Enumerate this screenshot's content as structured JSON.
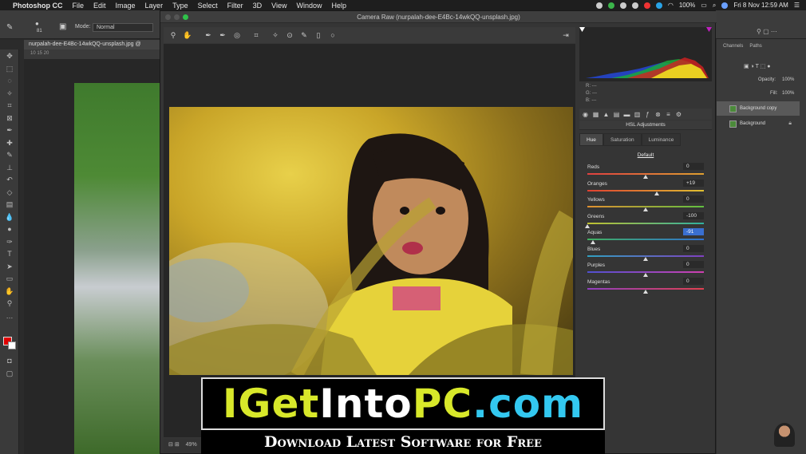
{
  "menubar": {
    "app": "Photoshop CC",
    "items": [
      "File",
      "Edit",
      "Image",
      "Layer",
      "Type",
      "Select",
      "Filter",
      "3D",
      "View",
      "Window",
      "Help"
    ],
    "battery": "100%",
    "datetime": "Fri 8 Nov  12:59 AM"
  },
  "options": {
    "mode_label": "Mode:",
    "mode_value": "Normal",
    "brush_size": "81"
  },
  "document": {
    "tab": "nurpalah-dee-E4Bc-14wkQQ-unsplash.jpg @",
    "ruler": "10      15      20"
  },
  "camera_raw": {
    "title": "Camera Raw (nurpalah-dee-E4Bc-14wkQQ-unsplash.jpg)",
    "zoom": "49%",
    "rgb": {
      "r": "R:  ---",
      "g": "G:  ---",
      "b": "B:  ---"
    },
    "panel_title": "HSL Adjustments",
    "tabs": [
      "Hue",
      "Saturation",
      "Luminance"
    ],
    "active_tab": "Hue",
    "default_label": "Default",
    "sliders": [
      {
        "label": "Reds",
        "value": "0",
        "level": 0,
        "colors": [
          "#e04040",
          "#e0a030"
        ]
      },
      {
        "label": "Oranges",
        "value": "+19",
        "level": 19,
        "colors": [
          "#e04030",
          "#e0c030"
        ]
      },
      {
        "label": "Yellows",
        "value": "0",
        "level": 0,
        "colors": [
          "#e09030",
          "#60c040"
        ]
      },
      {
        "label": "Greens",
        "value": "-100",
        "level": -100,
        "colors": [
          "#c0c030",
          "#30b0a0"
        ]
      },
      {
        "label": "Aquas",
        "value": "-91",
        "level": -91,
        "colors": [
          "#40b060",
          "#3070d0"
        ],
        "highlight": true
      },
      {
        "label": "Blues",
        "value": "0",
        "level": 0,
        "colors": [
          "#30a0c0",
          "#8040c0"
        ]
      },
      {
        "label": "Purples",
        "value": "0",
        "level": 0,
        "colors": [
          "#5050d0",
          "#d040b0"
        ]
      },
      {
        "label": "Magentas",
        "value": "0",
        "level": 0,
        "colors": [
          "#9040c0",
          "#e04050"
        ]
      }
    ]
  },
  "right_panel": {
    "tabs": [
      "Channels",
      "Paths"
    ],
    "opacity_label": "Opacity:",
    "opacity_value": "100%",
    "fill_label": "Fill:",
    "fill_value": "100%",
    "layers": [
      "Background copy",
      "Background"
    ]
  },
  "watermark": {
    "title_parts": [
      {
        "text": "IGet",
        "color": "#d8e82a"
      },
      {
        "text": "Into",
        "color": "#ffffff"
      },
      {
        "text": "PC",
        "color": "#d8e82a"
      },
      {
        "text": ".com",
        "color": "#33c8f0"
      }
    ],
    "subtitle": "Download Latest Software for Free"
  }
}
